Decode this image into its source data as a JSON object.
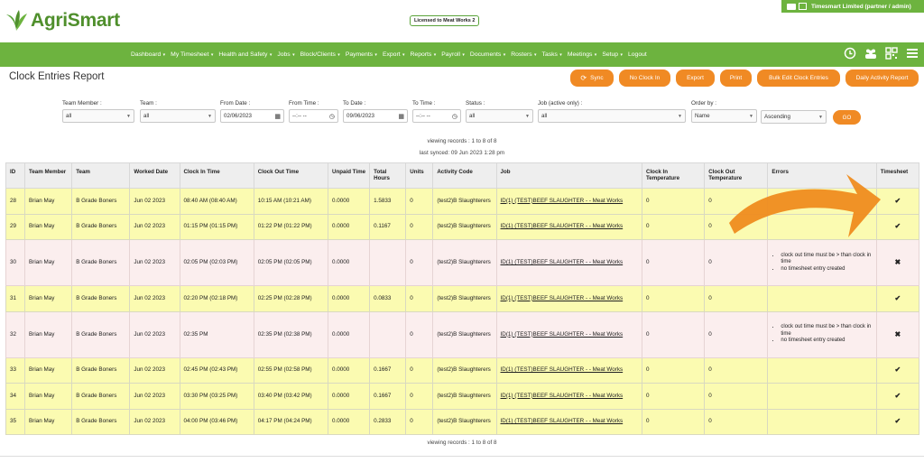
{
  "app": {
    "name": "AgriSmart",
    "license": "Licensed to Meat Works 2",
    "user": "Timesmart Limited (partner / admin)"
  },
  "nav": [
    {
      "label": "Dashboard",
      "caret": true
    },
    {
      "label": "My Timesheet",
      "caret": true
    },
    {
      "label": "Health and Safety",
      "caret": true
    },
    {
      "label": "Jobs",
      "caret": true
    },
    {
      "label": "Block/Clients",
      "caret": true
    },
    {
      "label": "Payments",
      "caret": true
    },
    {
      "label": "Export",
      "caret": true
    },
    {
      "label": "Reports",
      "caret": true
    },
    {
      "label": "Payroll",
      "caret": true
    },
    {
      "label": "Documents",
      "caret": true
    },
    {
      "label": "Rosters",
      "caret": true
    },
    {
      "label": "Tasks",
      "caret": true
    },
    {
      "label": "Meetings",
      "caret": true
    },
    {
      "label": "Setup",
      "caret": true
    },
    {
      "label": "Logout",
      "caret": false
    }
  ],
  "page": {
    "title": "Clock Entries Report"
  },
  "buttons": {
    "sync": "Sync",
    "no_clock_in": "No Clock In",
    "export": "Export",
    "print": "Print",
    "bulk_edit": "Bulk Edit Clock Entries",
    "daily_activity": "Daily Activity Report",
    "go": "GO"
  },
  "filters": {
    "team_member": {
      "label": "Team Member :",
      "value": "all"
    },
    "team": {
      "label": "Team :",
      "value": "all"
    },
    "from_date": {
      "label": "From Date :",
      "value": "02/06/2023"
    },
    "from_time": {
      "label": "From Time :",
      "value": "--:-- --"
    },
    "to_date": {
      "label": "To Date :",
      "value": "09/06/2023"
    },
    "to_time": {
      "label": "To Time :",
      "value": "--:-- --"
    },
    "status": {
      "label": "Status :",
      "value": "all"
    },
    "job": {
      "label": "Job (active only) :",
      "value": "all"
    },
    "order_by": {
      "label": "Order by :",
      "value": "Name"
    },
    "order_dir": {
      "value": "Ascending"
    }
  },
  "records_info": "viewing records : 1 to 8 of 8",
  "last_synced": "last synced: 09 Jun 2023 1:28 pm",
  "table": {
    "headers": [
      "ID",
      "Team Member",
      "Team",
      "Worked Date",
      "Clock In Time",
      "Clock Out Time",
      "Unpaid Time",
      "Total Hours",
      "Units",
      "Activity Code",
      "Job",
      "Clock In Temperature",
      "Clock Out Temperature",
      "Errors",
      "Timesheet"
    ],
    "rows": [
      {
        "id": "28",
        "member": "Brian May",
        "team": "B Grade Boners",
        "date": "Jun 02 2023",
        "in": "08:40 AM (08:40 AM)",
        "out": "10:15 AM (10:21 AM)",
        "unpaid": "0.0000",
        "total": "1.5833",
        "units": "0",
        "activity": "(test2)B Slaughterers",
        "job": "ID(1) (TEST)BEEF SLAUGHTER - - Meat Works",
        "in_temp": "0",
        "out_temp": "0",
        "errors": [],
        "ts": "✔",
        "status": "ok"
      },
      {
        "id": "29",
        "member": "Brian May",
        "team": "B Grade Boners",
        "date": "Jun 02 2023",
        "in": "01:15 PM (01:15 PM)",
        "out": "01:22 PM (01:22 PM)",
        "unpaid": "0.0000",
        "total": "0.1167",
        "units": "0",
        "activity": "(test2)B Slaughterers",
        "job": "ID(1) (TEST)BEEF SLAUGHTER - - Meat Works",
        "in_temp": "0",
        "out_temp": "0",
        "errors": [],
        "ts": "✔",
        "status": "ok"
      },
      {
        "id": "30",
        "member": "Brian May",
        "team": "B Grade Boners",
        "date": "Jun 02 2023",
        "in": "02:05 PM (02:03 PM)",
        "out": "02:05 PM (02:05 PM)",
        "unpaid": "0.0000",
        "total": "",
        "units": "0",
        "activity": "(test2)B Slaughterers",
        "job": "ID(1) (TEST)BEEF SLAUGHTER - - Meat Works",
        "in_temp": "0",
        "out_temp": "0",
        "errors": [
          "clock out time must be > than clock in time",
          "no timesheet entry created"
        ],
        "ts": "✖",
        "status": "err"
      },
      {
        "id": "31",
        "member": "Brian May",
        "team": "B Grade Boners",
        "date": "Jun 02 2023",
        "in": "02:20 PM (02:18 PM)",
        "out": "02:25 PM (02:28 PM)",
        "unpaid": "0.0000",
        "total": "0.0833",
        "units": "0",
        "activity": "(test2)B Slaughterers",
        "job": "ID(1) (TEST)BEEF SLAUGHTER - - Meat Works",
        "in_temp": "0",
        "out_temp": "0",
        "errors": [],
        "ts": "✔",
        "status": "ok"
      },
      {
        "id": "32",
        "member": "Brian May",
        "team": "B Grade Boners",
        "date": "Jun 02 2023",
        "in": "02:35 PM",
        "out": "02:35 PM (02:38 PM)",
        "unpaid": "0.0000",
        "total": "",
        "units": "0",
        "activity": "(test2)B Slaughterers",
        "job": "ID(1) (TEST)BEEF SLAUGHTER - - Meat Works",
        "in_temp": "0",
        "out_temp": "0",
        "errors": [
          "clock out time must be > than clock in time",
          "no timesheet entry created"
        ],
        "ts": "✖",
        "status": "err"
      },
      {
        "id": "33",
        "member": "Brian May",
        "team": "B Grade Boners",
        "date": "Jun 02 2023",
        "in": "02:45 PM (02:43 PM)",
        "out": "02:55 PM (02:58 PM)",
        "unpaid": "0.0000",
        "total": "0.1667",
        "units": "0",
        "activity": "(test2)B Slaughterers",
        "job": "ID(1) (TEST)BEEF SLAUGHTER - - Meat Works",
        "in_temp": "0",
        "out_temp": "0",
        "errors": [],
        "ts": "✔",
        "status": "ok"
      },
      {
        "id": "34",
        "member": "Brian May",
        "team": "B Grade Boners",
        "date": "Jun 02 2023",
        "in": "03:30 PM (03:25 PM)",
        "out": "03:40 PM (03:42 PM)",
        "unpaid": "0.0000",
        "total": "0.1667",
        "units": "0",
        "activity": "(test2)B Slaughterers",
        "job": "ID(1) (TEST)BEEF SLAUGHTER - - Meat Works",
        "in_temp": "0",
        "out_temp": "0",
        "errors": [],
        "ts": "✔",
        "status": "ok"
      },
      {
        "id": "35",
        "member": "Brian May",
        "team": "B Grade Boners",
        "date": "Jun 02 2023",
        "in": "04:00 PM (03:46 PM)",
        "out": "04:17 PM (04:24 PM)",
        "unpaid": "0.0000",
        "total": "0.2833",
        "units": "0",
        "activity": "(test2)B Slaughterers",
        "job": "ID(1) (TEST)BEEF SLAUGHTER - - Meat Works",
        "in_temp": "0",
        "out_temp": "0",
        "errors": [],
        "ts": "✔",
        "status": "ok"
      }
    ]
  },
  "colors": {
    "brand_green": "#6db33f",
    "accent_orange": "#f08a24",
    "row_ok": "#fbfbb1",
    "row_error": "#fbeeee"
  },
  "icons": {
    "user_bar": [
      "mail-icon",
      "card-icon"
    ],
    "nav_right": [
      "clock-icon",
      "team-icon",
      "qr-code-icon",
      "list-icon"
    ],
    "sync": "sync-icon"
  }
}
